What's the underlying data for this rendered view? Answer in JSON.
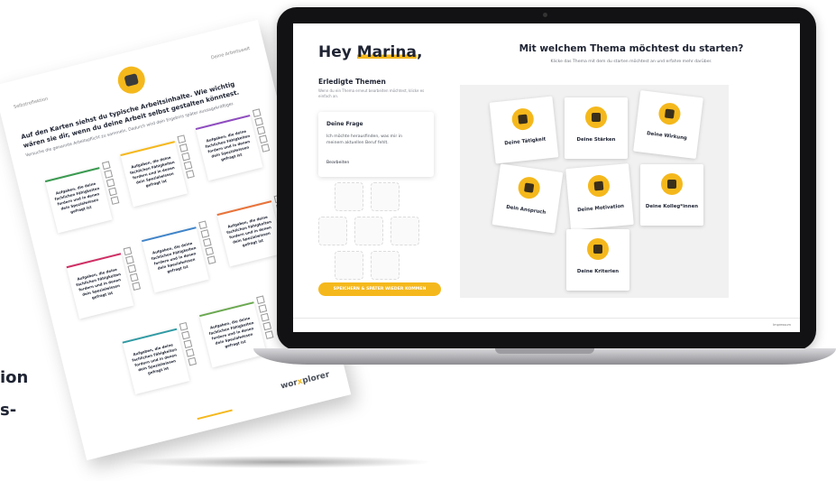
{
  "screen": {
    "greeting_prefix": "Hey ",
    "greeting_name": "Marina",
    "greeting_suffix": ",",
    "done_title": "Erledigte Themen",
    "done_sub": "Wenn du ein Thema erneut bearbeiten möchtest, klicke es einfach an.",
    "question_card": {
      "title": "Deine Frage",
      "text": "Ich möchte herausfinden, was mir in meinem aktuellen Beruf fehlt.",
      "edit": "Bearbeiten"
    },
    "save_button": "SPEICHERN & SPÄTER WIEDER KOMMEN",
    "topic_title": "Mit welchem Thema möchtest du starten?",
    "topic_sub": "Klicke das Thema mit dem du starten möchtest an und erfahre mehr darüber.",
    "topics": [
      {
        "label": "Deine Tätigkeit"
      },
      {
        "label": "Deine Stärken"
      },
      {
        "label": "Deine Wirkung"
      },
      {
        "label": "Dein Anspruch"
      },
      {
        "label": "Deine Motivation"
      },
      {
        "label": "Deine Kolleg*innen"
      },
      {
        "label": "Deine Kriterien"
      }
    ],
    "impressum": "Impressum"
  },
  "sheet": {
    "header_left": "Selbstreflektion",
    "header_right": "Deine Arbeitswelt",
    "title": "Auf den Karten siehst du typische Arbeitsinhalte. Wie wichtig wären sie dir, wenn du deine Arbeit selbst gestalten könntest.",
    "note": "Versuche die genannte Arbeitspflicht zu sammeln. Dadurch wird dein Ergebnis später aussagekräftiger.",
    "card_text": "Aufgaben, die deine fachlichen Fähigkeiten fordern und in denen dein Spezialwissen gefragt ist",
    "brand_a": "wor",
    "brand_b": "x",
    "brand_c": "plorer"
  },
  "edge": {
    "line1": "ion",
    "line2": "s-"
  },
  "colors": {
    "accent": "#f5b81c",
    "text": "#1f2433",
    "card_bars": [
      "#3a9a50",
      "#f5b81c",
      "#8e4bbf",
      "#cf2e64",
      "#3f84c9",
      "#e8733a",
      "#2f9aa3",
      "#6aa84f"
    ]
  }
}
